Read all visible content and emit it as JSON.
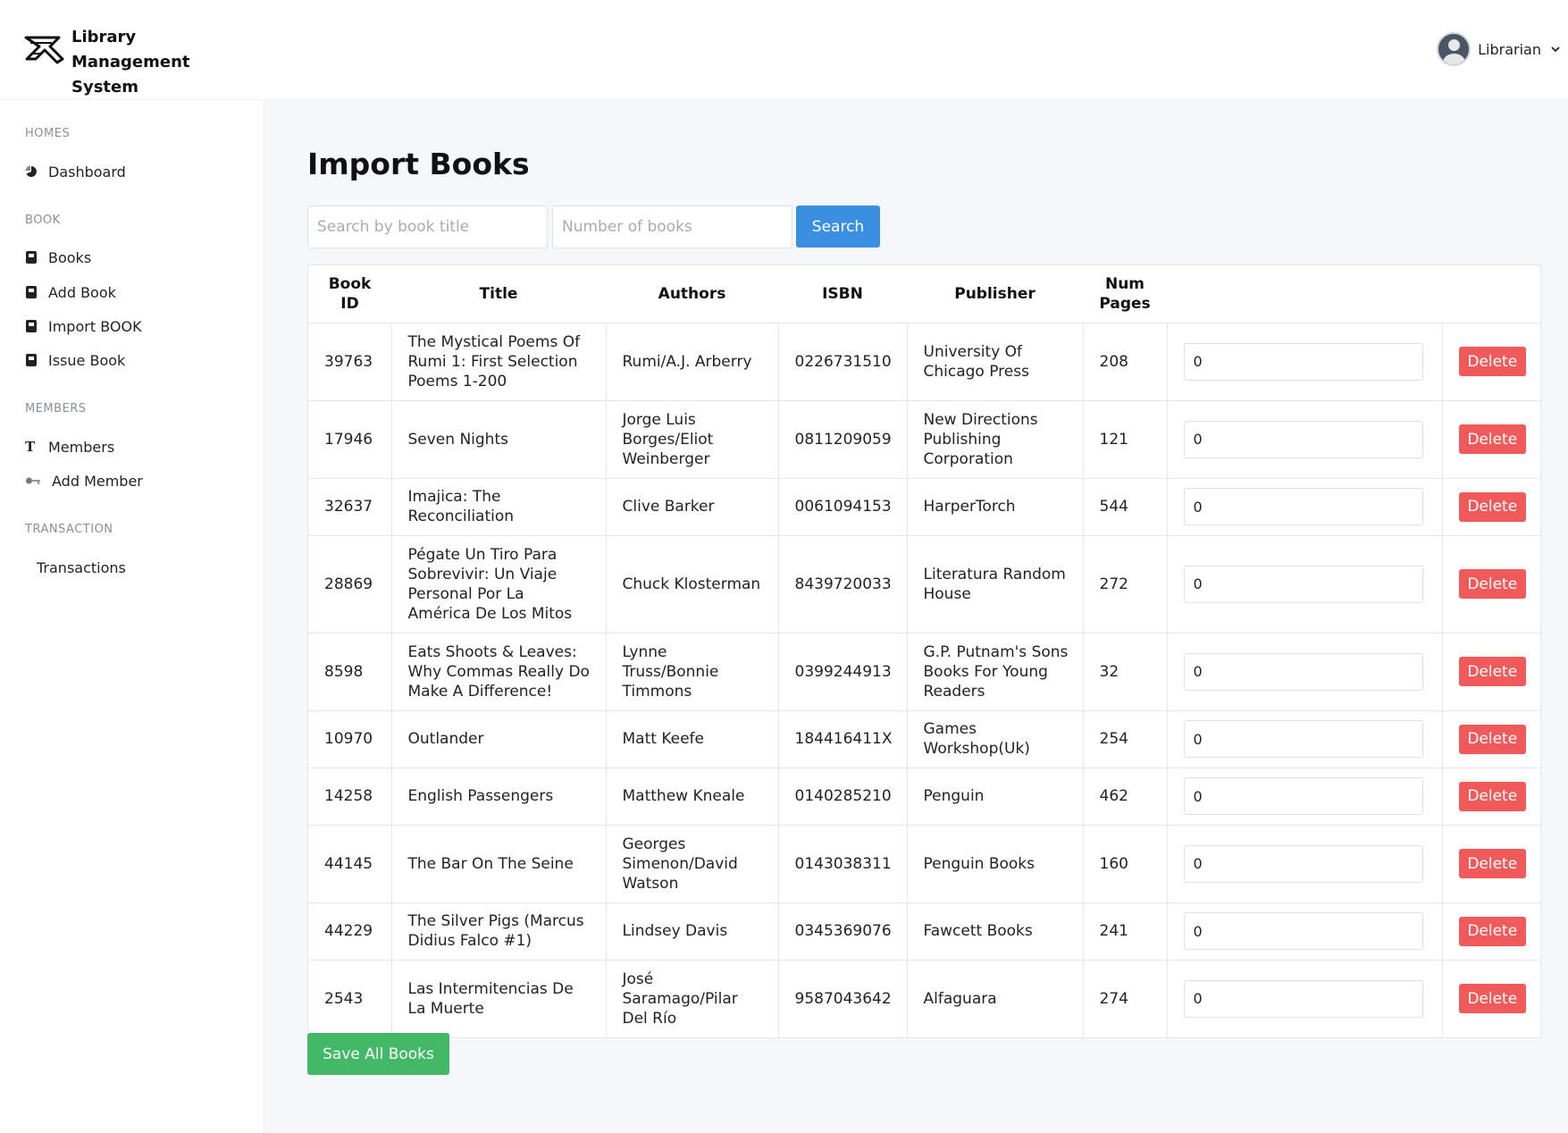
{
  "app": {
    "title": "Library Management System",
    "title_line1": "Library Management",
    "title_line2": "System"
  },
  "user": {
    "name": "Librarian"
  },
  "sidebar": {
    "sections": [
      {
        "label": "HOMES",
        "items": [
          {
            "label": "Dashboard",
            "icon": "pie-chart-icon"
          }
        ]
      },
      {
        "label": "BOOK",
        "items": [
          {
            "label": "Books",
            "icon": "book-icon"
          },
          {
            "label": "Add Book",
            "icon": "book-icon"
          },
          {
            "label": "Import BOOK",
            "icon": "book-icon"
          },
          {
            "label": "Issue Book",
            "icon": "book-icon"
          }
        ]
      },
      {
        "label": "MEMBERS",
        "items": [
          {
            "label": "Members",
            "icon": "text-t-icon"
          },
          {
            "label": "Add Member",
            "icon": "key-icon"
          }
        ]
      },
      {
        "label": "TRANSACTION",
        "items": [
          {
            "label": "Transactions",
            "icon": ""
          }
        ]
      }
    ]
  },
  "main": {
    "title": "Import Books",
    "search": {
      "title_placeholder": "Search by book title",
      "count_placeholder": "Number of books",
      "button": "Search"
    },
    "table": {
      "headers": [
        "Book ID",
        "Title",
        "Authors",
        "ISBN",
        "Publisher",
        "Num Pages",
        "",
        ""
      ],
      "header_lines": {
        "book_id": [
          "Book",
          "ID"
        ],
        "num_pages": [
          "Num",
          "Pages"
        ]
      },
      "delete_label": "Delete",
      "rows": [
        {
          "id": "39763",
          "title": "The Mystical Poems Of Rumi 1: First Selection Poems 1-200",
          "authors": "Rumi/A.J. Arberry",
          "isbn": "0226731510",
          "publisher": "University Of Chicago Press",
          "pages": "208",
          "qty": "0"
        },
        {
          "id": "17946",
          "title": "Seven Nights",
          "authors": "Jorge Luis Borges/Eliot Weinberger",
          "isbn": "0811209059",
          "publisher": "New Directions Publishing Corporation",
          "pages": "121",
          "qty": "0"
        },
        {
          "id": "32637",
          "title": "Imajica: The Reconciliation",
          "authors": "Clive Barker",
          "isbn": "0061094153",
          "publisher": "HarperTorch",
          "pages": "544",
          "qty": "0"
        },
        {
          "id": "28869",
          "title": "Pégate Un Tiro Para Sobrevivir: Un Viaje Personal Por La América De Los Mitos",
          "authors": "Chuck Klosterman",
          "isbn": "8439720033",
          "publisher": "Literatura Random House",
          "pages": "272",
          "qty": "0"
        },
        {
          "id": "8598",
          "title": "Eats Shoots & Leaves: Why Commas Really Do Make A Difference!",
          "authors": "Lynne Truss/Bonnie Timmons",
          "isbn": "0399244913",
          "publisher": "G.P. Putnam's Sons Books For Young Readers",
          "pages": "32",
          "qty": "0"
        },
        {
          "id": "10970",
          "title": "Outlander",
          "authors": "Matt Keefe",
          "isbn": "184416411X",
          "publisher": "Games Workshop(Uk)",
          "pages": "254",
          "qty": "0"
        },
        {
          "id": "14258",
          "title": "English Passengers",
          "authors": "Matthew Kneale",
          "isbn": "0140285210",
          "publisher": "Penguin",
          "pages": "462",
          "qty": "0"
        },
        {
          "id": "44145",
          "title": "The Bar On The Seine",
          "authors": "Georges Simenon/David Watson",
          "isbn": "0143038311",
          "publisher": "Penguin Books",
          "pages": "160",
          "qty": "0"
        },
        {
          "id": "44229",
          "title": "The Silver Pigs (Marcus Didius Falco #1)",
          "authors": "Lindsey Davis",
          "isbn": "0345369076",
          "publisher": "Fawcett Books",
          "pages": "241",
          "qty": "0"
        },
        {
          "id": "2543",
          "title": "Las Intermitencias De La Muerte",
          "authors": "José Saramago/Pilar Del Río",
          "isbn": "9587043642",
          "publisher": "Alfaguara",
          "pages": "274",
          "qty": "0"
        }
      ]
    },
    "save_button": "Save All Books"
  },
  "colors": {
    "primary": "#3b8fe0",
    "danger": "#f05a5a",
    "success": "#43b968"
  }
}
